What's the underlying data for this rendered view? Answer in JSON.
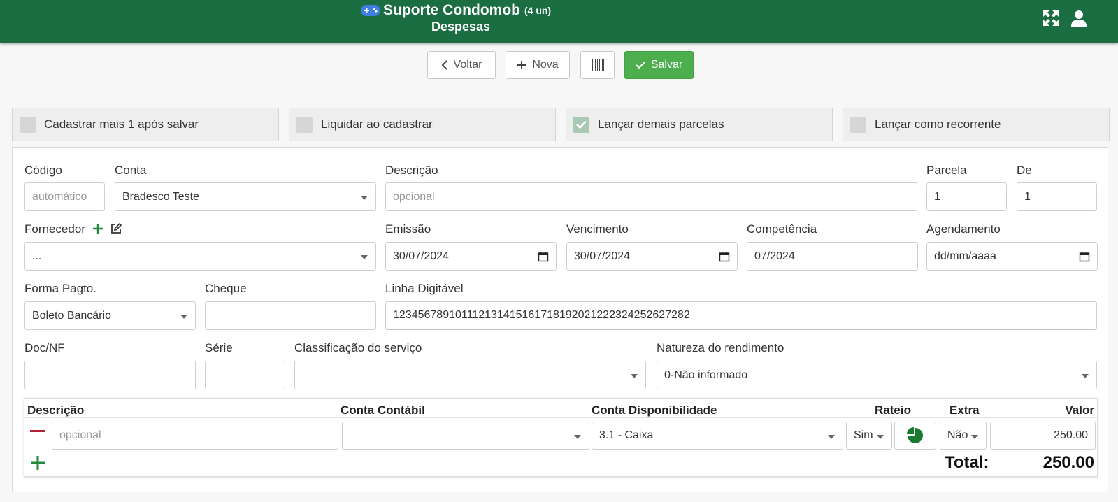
{
  "header": {
    "app_name": "Suporte Condomob",
    "units": "(4 un)",
    "subtitle": "Despesas",
    "icons": [
      "gamepad-icon",
      "fullscreen-icon",
      "user-icon"
    ]
  },
  "toolbar": {
    "back_label": "Voltar",
    "new_label": "Nova",
    "save_label": "Salvar"
  },
  "options": [
    {
      "label": "Cadastrar mais 1 após salvar",
      "checked": false
    },
    {
      "label": "Liquidar ao cadastrar",
      "checked": false
    },
    {
      "label": "Lançar demais parcelas",
      "checked": true
    },
    {
      "label": "Lançar como recorrente",
      "checked": false
    }
  ],
  "form": {
    "codigo": {
      "label": "Código",
      "placeholder": "automático"
    },
    "conta": {
      "label": "Conta",
      "value": "Bradesco Teste"
    },
    "descricao": {
      "label": "Descrição",
      "placeholder": "opcional"
    },
    "parcela": {
      "label": "Parcela",
      "value": "1"
    },
    "de": {
      "label": "De",
      "value": "1"
    },
    "fornecedor": {
      "label": "Fornecedor",
      "value": "..."
    },
    "emissao": {
      "label": "Emissão",
      "value": "30/07/2024"
    },
    "vencimento": {
      "label": "Vencimento",
      "value": "30/07/2024"
    },
    "competencia": {
      "label": "Competência",
      "value": "07/2024"
    },
    "agendamento": {
      "label": "Agendamento",
      "placeholder": "dd/mm/aaaa"
    },
    "forma_pagto": {
      "label": "Forma Pagto.",
      "value": "Boleto Bancário"
    },
    "cheque": {
      "label": "Cheque",
      "value": ""
    },
    "linha_digitavel": {
      "label": "Linha Digitável",
      "value": "1234567891011121314151617181920212223242526272​82"
    },
    "doc_nf": {
      "label": "Doc/NF",
      "value": ""
    },
    "serie": {
      "label": "Série",
      "value": ""
    },
    "classificacao": {
      "label": "Classificação do serviço",
      "value": ""
    },
    "natureza": {
      "label": "Natureza do rendimento",
      "value": "0-Não informado"
    }
  },
  "grid": {
    "headers": {
      "descricao": "Descrição",
      "conta_contabil": "Conta Contábil",
      "conta_disponibilidade": "Conta Disponibilidade",
      "rateio": "Rateio",
      "extra": "Extra",
      "valor": "Valor"
    },
    "rows": [
      {
        "descricao_placeholder": "opcional",
        "conta_contabil": "",
        "conta_disponibilidade": "3.1 - Caixa",
        "rateio": "Sim",
        "extra": "Não",
        "valor": "250.00"
      }
    ],
    "total_label": "Total:",
    "total_value": "250.00"
  },
  "colors": {
    "header_green": "#1a6e42",
    "save_green": "#4cae4c",
    "remove_red": "#b22234",
    "add_green": "#1f8a3a"
  }
}
